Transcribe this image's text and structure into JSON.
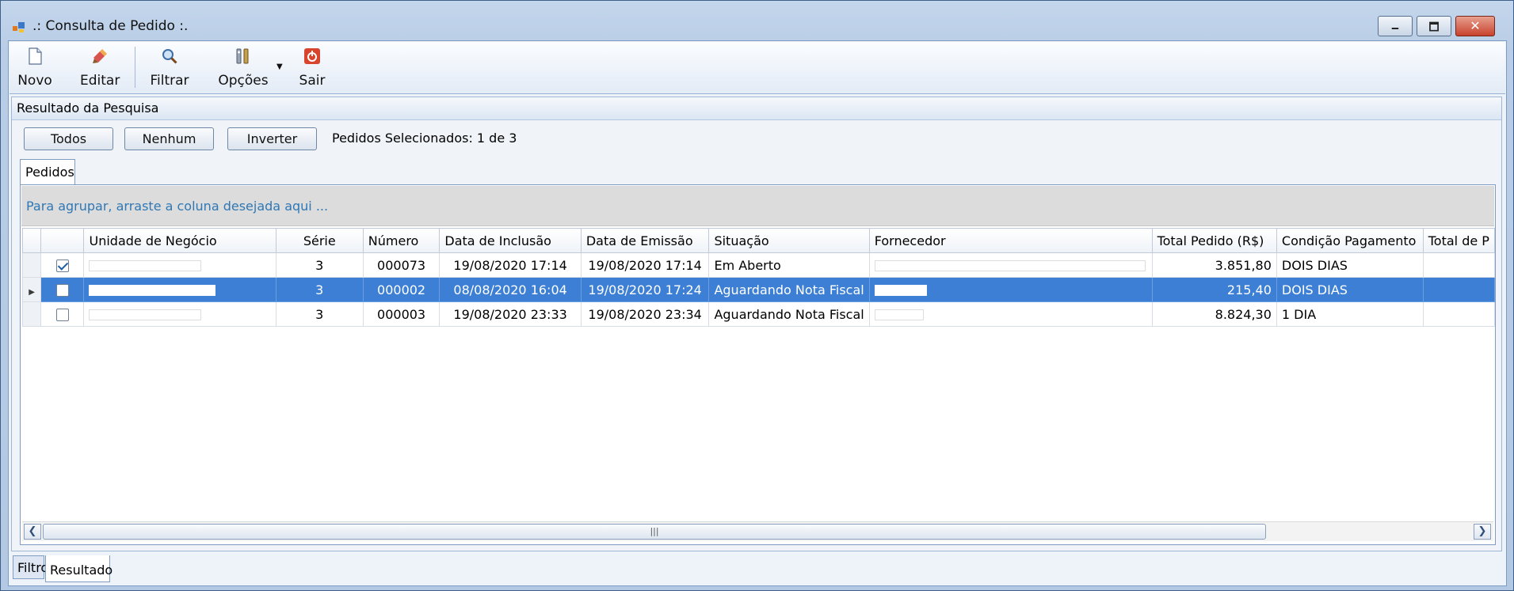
{
  "window": {
    "title": ".: Consulta de Pedido :.",
    "controls": {
      "minimize": "🗕",
      "maximize": "🗖",
      "close": "✕"
    }
  },
  "toolbar": {
    "items": [
      {
        "label": "Novo",
        "icon": "new-document-icon"
      },
      {
        "label": "Editar",
        "icon": "edit-brush-icon"
      },
      {
        "label": "Filtrar",
        "icon": "magnifier-icon"
      },
      {
        "label": "Opções",
        "icon": "options-tools-icon"
      },
      {
        "label": "Sair",
        "icon": "exit-power-icon"
      }
    ]
  },
  "panel": {
    "title": "Resultado da Pesquisa",
    "buttons": {
      "all": "Todos",
      "none": "Nenhum",
      "invert": "Inverter"
    },
    "selection_status": "Pedidos Selecionados: 1 de 3",
    "tab": "Pedidos",
    "group_hint": "Para agrupar, arraste a coluna desejada aqui ..."
  },
  "grid": {
    "columns": [
      "Unidade de Negócio",
      "Série",
      "Número",
      "Data de Inclusão",
      "Data de Emissão",
      "Situação",
      "Fornecedor",
      "Total Pedido (R$)",
      "Condição Pagamento",
      "Total de P"
    ],
    "rows": [
      {
        "checked": true,
        "selected": false,
        "serie": "3",
        "numero": "000073",
        "inclusao": "19/08/2020 17:14",
        "emissao": "19/08/2020 17:14",
        "situacao": "Em Aberto",
        "total": "3.851,80",
        "condicao": "DOIS DIAS"
      },
      {
        "checked": false,
        "selected": true,
        "serie": "3",
        "numero": "000002",
        "inclusao": "08/08/2020 16:04",
        "emissao": "19/08/2020 17:24",
        "situacao": "Aguardando Nota Fiscal",
        "total": "215,40",
        "condicao": "DOIS DIAS"
      },
      {
        "checked": false,
        "selected": false,
        "serie": "3",
        "numero": "000003",
        "inclusao": "19/08/2020 23:33",
        "emissao": "19/08/2020 23:34",
        "situacao": "Aguardando Nota Fiscal",
        "total": "8.824,30",
        "condicao": "1 DIA"
      }
    ]
  },
  "scrollbar": {
    "grip": "|||"
  },
  "bottom_tabs": [
    "Filtro",
    "Resultado"
  ],
  "active_bottom_tab": "Resultado",
  "colors": {
    "selection": "#3c7fd4",
    "group_hint": "#2f78b5",
    "title_gradient": "#c3d6ec"
  }
}
